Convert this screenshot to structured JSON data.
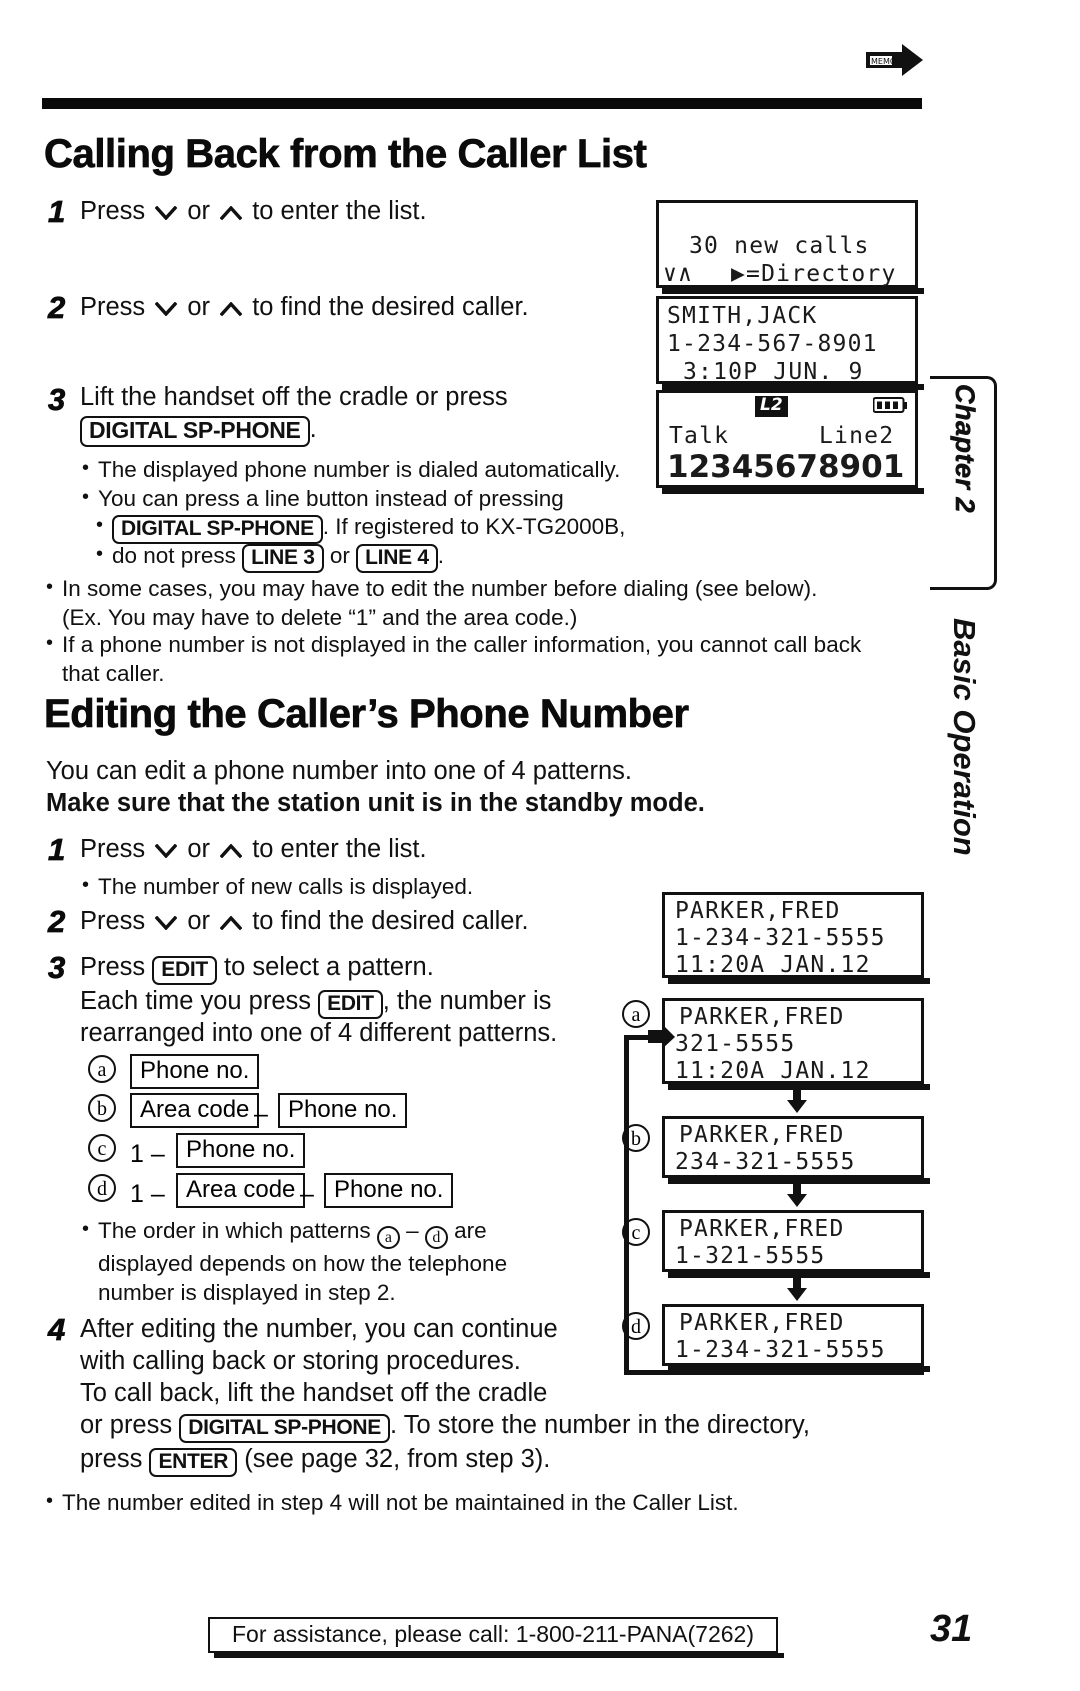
{
  "page": {
    "number": "31",
    "chapter_tab": "Chapter 2",
    "chapter_side_text": "Basic Operation",
    "top_arrow_label": "continue-arrow-icon"
  },
  "sections": {
    "calling_back": {
      "heading": "Calling Back from the Caller List",
      "steps": [
        {
          "num": "1",
          "pre": "Press ",
          "mid": " or ",
          "post": " to enter the list."
        },
        {
          "num": "2",
          "pre": "Press ",
          "mid": " or ",
          "post": " to find the desired caller."
        },
        {
          "num": "3",
          "line1": "Lift the handset off the cradle or press",
          "key": "DIGITAL SP-PHONE",
          "after_key": "."
        }
      ],
      "step3_bullets": [
        {
          "text": "The displayed phone number is dialed automatically."
        },
        {
          "part1": "You can press a line button instead of pressing",
          "key1": "DIGITAL SP-PHONE",
          "part2": ". If registered to KX-TG2000B,",
          "part3": "do not press ",
          "key2": "LINE 3",
          "part4": " or ",
          "key3": "LINE 4",
          "part5": "."
        }
      ],
      "notes": [
        "In some cases, you may have to edit the number before dialing (see below).\n(Ex. You may have to delete “1” and the area code.)",
        "If a phone number is not displayed in the caller information, you cannot call back\nthat caller."
      ]
    },
    "editing": {
      "heading": "Editing the Caller’s Phone Number",
      "intro": "You can edit a phone number into one of 4 patterns.",
      "intro_bold": "Make sure that the station unit is in the standby mode.",
      "steps": [
        {
          "num": "1",
          "pre": "Press ",
          "mid": " or ",
          "post": " to enter the list."
        },
        {
          "num": "2",
          "pre": "Press ",
          "mid": " or ",
          "post": " to find the desired caller."
        },
        {
          "num": "3",
          "line1_pre": "Press ",
          "line1_key": "EDIT",
          "line1_post": " to select a pattern.",
          "line2_pre": "Each time you press ",
          "line2_key": "EDIT",
          "line2_post": ", the number is",
          "line3": "rearranged into one of 4 different patterns."
        },
        {
          "num": "4",
          "line1": "After editing the number, you can continue",
          "line2": "with calling back or storing procedures.",
          "line3": "To call back, lift the handset off the cradle",
          "line4_pre": "or press ",
          "line4_key": "DIGITAL SP-PHONE",
          "line4_post": ". To store the number in the directory,",
          "line5_pre": "press ",
          "line5_key": "ENTER",
          "line5_post": " (see page 32, from step 3)."
        }
      ],
      "step1_bullet": "The number of new calls is displayed.",
      "patterns": [
        {
          "label": "a",
          "lead": "",
          "boxes": [
            "Phone no."
          ],
          "dashes": 0
        },
        {
          "label": "b",
          "lead": "",
          "boxes": [
            "Area code",
            "Phone no."
          ],
          "dashes": 1
        },
        {
          "label": "c",
          "lead": "1 –",
          "boxes": [
            "Phone no."
          ],
          "dashes": 0
        },
        {
          "label": "d",
          "lead": "1 –",
          "boxes": [
            "Area code",
            "Phone no."
          ],
          "dashes": 1
        }
      ],
      "pattern_note_pre": "The order in which patterns ",
      "pattern_note_a": "a",
      "pattern_note_mid": " – ",
      "pattern_note_d": "d",
      "pattern_note_post": " are\ndisplayed depends on how the telephone\nnumber is displayed in step 2.",
      "final_note": "The number edited in step 4 will not be maintained in the Caller List."
    }
  },
  "lcd_displays": {
    "new_calls": {
      "line1": "30 new calls",
      "line2_left": "∨∧",
      "line2_right": "▶=Directory"
    },
    "smith": {
      "line1": "SMITH,JACK",
      "line2": "1-234-567-8901",
      "line3": "3:10P JUN. 9"
    },
    "talk": {
      "badge": "L2",
      "battery_icon": "battery-full-icon",
      "line1_left": "Talk",
      "line1_right": "Line2",
      "number": "12345678901"
    },
    "parker_original": {
      "line1": "PARKER,FRED",
      "line2": "1-234-321-5555",
      "line3": "11:20A JAN.12"
    },
    "pattern_screens": [
      {
        "label": "a",
        "line1": "PARKER,FRED",
        "line2": "321-5555",
        "line3": "11:20A JAN.12"
      },
      {
        "label": "b",
        "line1": "PARKER,FRED",
        "line2": "234-321-5555",
        "line3": ""
      },
      {
        "label": "c",
        "line1": "PARKER,FRED",
        "line2": "1-321-5555",
        "line3": ""
      },
      {
        "label": "d",
        "line1": "PARKER,FRED",
        "line2": "1-234-321-5555",
        "line3": ""
      }
    ]
  },
  "footer": {
    "assistance": "For assistance, please call: 1-800-211-PANA(7262)"
  }
}
